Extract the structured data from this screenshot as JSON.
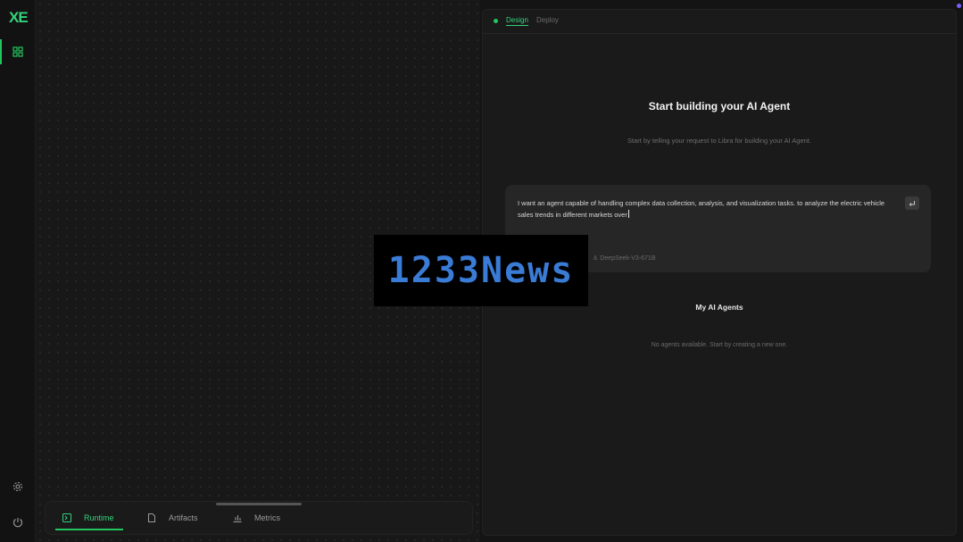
{
  "brand": {
    "logo_text": "XE",
    "accent": "#22c55e"
  },
  "rail": {
    "items": [
      {
        "name": "dashboard",
        "icon": "grid-icon",
        "active": true
      }
    ],
    "bottom": [
      {
        "name": "settings",
        "icon": "gear-icon"
      },
      {
        "name": "logout",
        "icon": "power-icon"
      }
    ]
  },
  "canvas": {
    "tabs": [
      {
        "label": "Runtime",
        "icon": "terminal-icon",
        "active": true
      },
      {
        "label": "Artifacts",
        "icon": "file-icon",
        "active": false
      },
      {
        "label": "Metrics",
        "icon": "bar-chart-icon",
        "active": false
      }
    ]
  },
  "panel": {
    "tabs": {
      "design": "Design",
      "deploy": "Deploy"
    },
    "title": "Start building your AI Agent",
    "subtitle": "Start by telling your request to Libra for building your AI Agent.",
    "prompt": {
      "value": "I want an agent capable of handling complex data collection, analysis, and visualization tasks. to analyze the electric vehicle sales trends in different markets over",
      "model": "DeepSeek-V3-671B",
      "send_icon": "enter-icon"
    },
    "agents": {
      "title": "My AI Agents",
      "empty": "No agents available. Start by creating a new one."
    }
  },
  "watermark": {
    "text": "1233News"
  }
}
